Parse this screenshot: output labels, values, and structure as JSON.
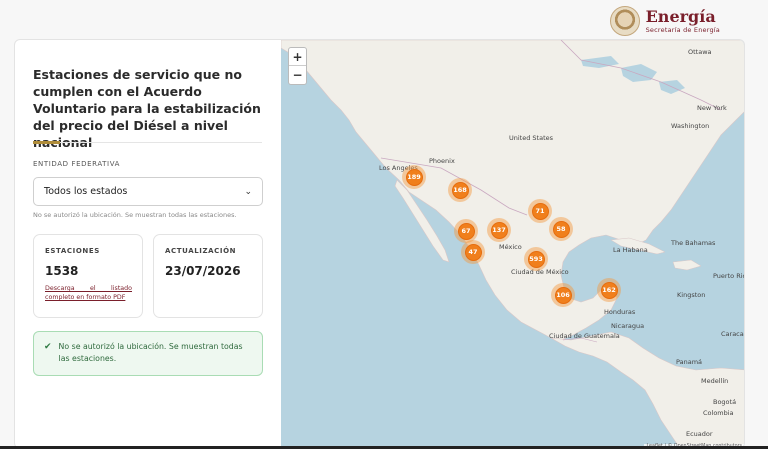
{
  "brand": {
    "name": "Energía",
    "subtitle": "Secretaría de Energía"
  },
  "panel": {
    "title": "Estaciones de servicio que no cumplen con el Acuerdo Voluntario para la estabilización del precio del Diésel a nivel nacional",
    "entidad_label": "ENTIDAD FEDERATIVA",
    "select_value": "Todos los estados",
    "location_note": "No se autorizó la ubicación. Se muestran todas las estaciones.",
    "stations": {
      "label": "ESTACIONES",
      "value": "1538",
      "link": "Descarga el listado completo en formato PDF"
    },
    "update": {
      "label": "ACTUALIZACIÓN",
      "value": "23/07/2026"
    },
    "alert": "No se autorizó la ubicación. Se muestran todas las estaciones."
  },
  "map": {
    "zoom_in": "+",
    "zoom_out": "−",
    "places": [
      "Ottawa",
      "New York",
      "Washington",
      "United States",
      "Phoenix",
      "Los Angeles",
      "México",
      "Ciudad de México",
      "La Habana",
      "The Bahamas",
      "Puerto Rico",
      "Kingston",
      "Honduras",
      "Nicaragua",
      "Ciudad de Guatemala",
      "Panamá",
      "Caracas",
      "Medellín",
      "Bogotá",
      "Colombia",
      "Ecuador"
    ],
    "clusters": [
      "189",
      "168",
      "71",
      "58",
      "67",
      "137",
      "47",
      "593",
      "106",
      "162"
    ],
    "attribution": "Leaflet | © OpenStreetMap contributors"
  }
}
